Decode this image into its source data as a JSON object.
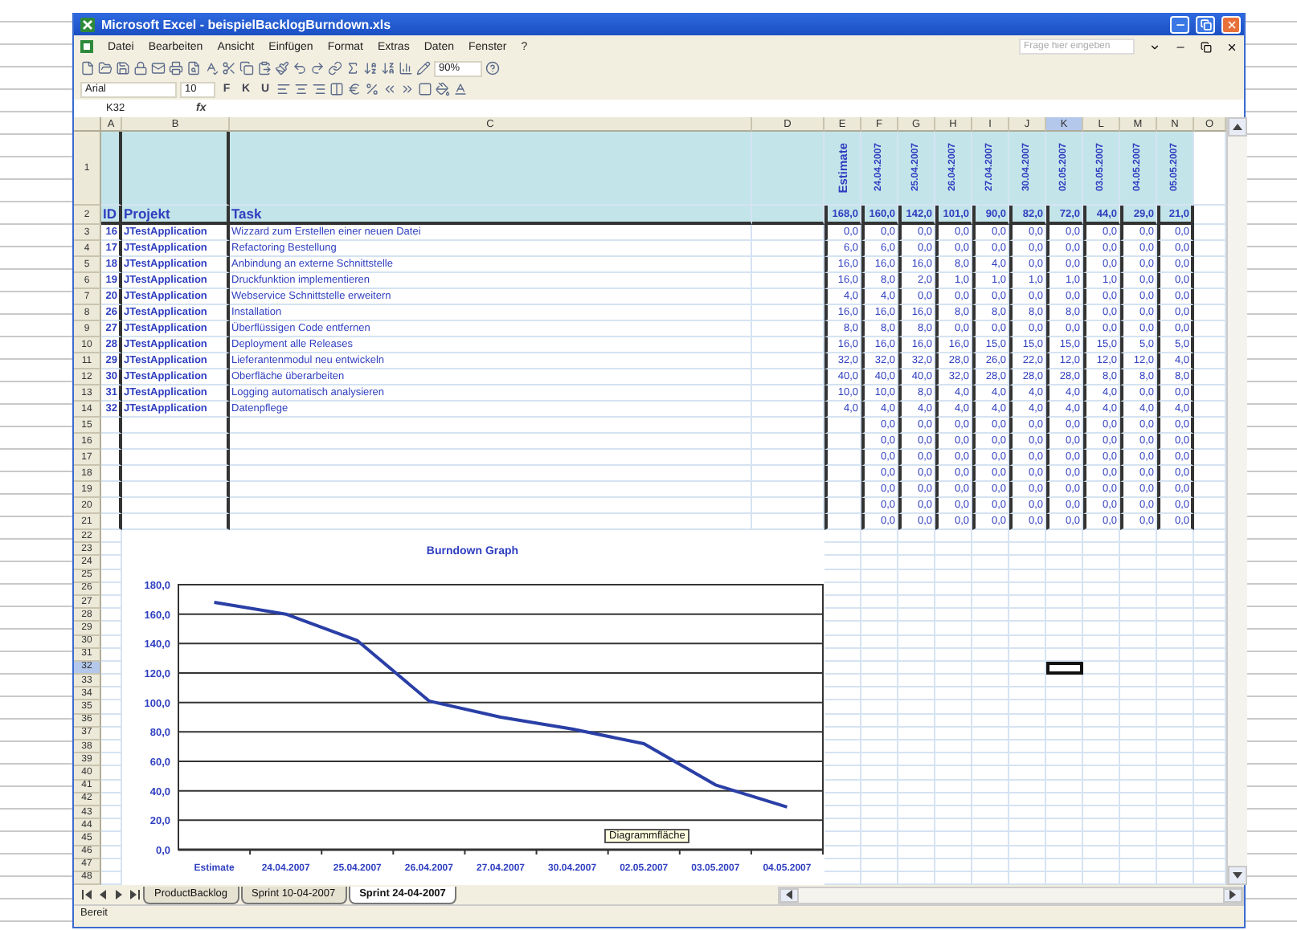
{
  "window": {
    "title": "Microsoft Excel - beispielBacklogBurndown.xls"
  },
  "menu": [
    "Datei",
    "Bearbeiten",
    "Ansicht",
    "Einfügen",
    "Format",
    "Extras",
    "Daten",
    "Fenster",
    "?"
  ],
  "help_box": {
    "placeholder": "Frage hier eingeben"
  },
  "toolbar": {
    "zoom": "90%",
    "font": "Arial",
    "font_size": "10",
    "format_buttons": [
      "F",
      "K",
      "U"
    ]
  },
  "formula_bar": {
    "name_box": "K32",
    "function_label": "fx"
  },
  "column_headers": [
    {
      "label": "A",
      "selected": false
    },
    {
      "label": "B",
      "selected": false
    },
    {
      "label": "C",
      "selected": false
    },
    {
      "label": "D",
      "selected": false
    },
    {
      "label": "E",
      "selected": false
    },
    {
      "label": "F",
      "selected": false
    },
    {
      "label": "G",
      "selected": false
    },
    {
      "label": "H",
      "selected": false
    },
    {
      "label": "I",
      "selected": false
    },
    {
      "label": "J",
      "selected": false
    },
    {
      "label": "K",
      "selected": true
    },
    {
      "label": "L",
      "selected": false
    },
    {
      "label": "M",
      "selected": false
    },
    {
      "label": "N",
      "selected": false
    },
    {
      "label": "O",
      "selected": false
    }
  ],
  "sheet": {
    "header_rows": [
      {
        "number": "1",
        "selected": false
      },
      {
        "number": "2",
        "selected": false
      }
    ],
    "headings": {
      "id": "ID",
      "project": "Projekt",
      "task": "Task"
    },
    "day_columns": [
      {
        "label": "Estimate",
        "total": "168,0"
      },
      {
        "label": "24.04.2007",
        "total": "160,0"
      },
      {
        "label": "25.04.2007",
        "total": "142,0"
      },
      {
        "label": "26.04.2007",
        "total": "101,0"
      },
      {
        "label": "27.04.2007",
        "total": "90,0"
      },
      {
        "label": "30.04.2007",
        "total": "82,0"
      },
      {
        "label": "02.05.2007",
        "total": "72,0"
      },
      {
        "label": "03.05.2007",
        "total": "44,0"
      },
      {
        "label": "04.05.2007",
        "total": "29,0"
      },
      {
        "label": "05.05.2007",
        "total": "21,0"
      }
    ],
    "rows": [
      {
        "number": "3",
        "selected": false,
        "id": "16",
        "project": "JTestApplication",
        "task": "Wizzard zum Erstellen einer neuen Datei",
        "estimate": "0,0",
        "daily": [
          "0,0",
          "0,0",
          "0,0",
          "0,0",
          "0,0",
          "0,0",
          "0,0",
          "0,0",
          "0,0"
        ]
      },
      {
        "number": "4",
        "selected": false,
        "id": "17",
        "project": "JTestApplication",
        "task": "Refactoring Bestellung",
        "estimate": "6,0",
        "daily": [
          "6,0",
          "0,0",
          "0,0",
          "0,0",
          "0,0",
          "0,0",
          "0,0",
          "0,0",
          "0,0"
        ]
      },
      {
        "number": "5",
        "selected": false,
        "id": "18",
        "project": "JTestApplication",
        "task": "Anbindung an externe Schnittstelle",
        "estimate": "16,0",
        "daily": [
          "16,0",
          "16,0",
          "8,0",
          "4,0",
          "0,0",
          "0,0",
          "0,0",
          "0,0",
          "0,0"
        ]
      },
      {
        "number": "6",
        "selected": false,
        "id": "19",
        "project": "JTestApplication",
        "task": "Druckfunktion implementieren",
        "estimate": "16,0",
        "daily": [
          "8,0",
          "2,0",
          "1,0",
          "1,0",
          "1,0",
          "1,0",
          "1,0",
          "0,0",
          "0,0"
        ]
      },
      {
        "number": "7",
        "selected": false,
        "id": "20",
        "project": "JTestApplication",
        "task": "Webservice Schnittstelle erweitern",
        "estimate": "4,0",
        "daily": [
          "4,0",
          "0,0",
          "0,0",
          "0,0",
          "0,0",
          "0,0",
          "0,0",
          "0,0",
          "0,0"
        ]
      },
      {
        "number": "8",
        "selected": false,
        "id": "26",
        "project": "JTestApplication",
        "task": "Installation",
        "estimate": "16,0",
        "daily": [
          "16,0",
          "16,0",
          "8,0",
          "8,0",
          "8,0",
          "8,0",
          "0,0",
          "0,0",
          "0,0"
        ]
      },
      {
        "number": "9",
        "selected": false,
        "id": "27",
        "project": "JTestApplication",
        "task": "Überflüssigen Code entfernen",
        "estimate": "8,0",
        "daily": [
          "8,0",
          "8,0",
          "0,0",
          "0,0",
          "0,0",
          "0,0",
          "0,0",
          "0,0",
          "0,0"
        ]
      },
      {
        "number": "10",
        "selected": false,
        "id": "28",
        "project": "JTestApplication",
        "task": "Deployment alle Releases",
        "estimate": "16,0",
        "daily": [
          "16,0",
          "16,0",
          "16,0",
          "15,0",
          "15,0",
          "15,0",
          "15,0",
          "5,0",
          "5,0"
        ]
      },
      {
        "number": "11",
        "selected": false,
        "id": "29",
        "project": "JTestApplication",
        "task": "Lieferantenmodul neu entwickeln",
        "estimate": "32,0",
        "daily": [
          "32,0",
          "32,0",
          "28,0",
          "26,0",
          "22,0",
          "12,0",
          "12,0",
          "12,0",
          "4,0"
        ]
      },
      {
        "number": "12",
        "selected": false,
        "id": "30",
        "project": "JTestApplication",
        "task": "Oberfläche überarbeiten",
        "estimate": "40,0",
        "daily": [
          "40,0",
          "40,0",
          "32,0",
          "28,0",
          "28,0",
          "28,0",
          "8,0",
          "8,0",
          "8,0"
        ]
      },
      {
        "number": "13",
        "selected": false,
        "id": "31",
        "project": "JTestApplication",
        "task": "Logging automatisch analysieren",
        "estimate": "10,0",
        "daily": [
          "10,0",
          "8,0",
          "4,0",
          "4,0",
          "4,0",
          "4,0",
          "4,0",
          "0,0",
          "0,0"
        ]
      },
      {
        "number": "14",
        "selected": false,
        "id": "32",
        "project": "JTestApplication",
        "task": "Datenpflege",
        "estimate": "4,0",
        "daily": [
          "4,0",
          "4,0",
          "4,0",
          "4,0",
          "4,0",
          "4,0",
          "4,0",
          "4,0",
          "4,0"
        ]
      },
      {
        "number": "15",
        "selected": false,
        "daily": [
          "0,0",
          "0,0",
          "0,0",
          "0,0",
          "0,0",
          "0,0",
          "0,0",
          "0,0",
          "0,0"
        ]
      },
      {
        "number": "16",
        "selected": false,
        "daily": [
          "0,0",
          "0,0",
          "0,0",
          "0,0",
          "0,0",
          "0,0",
          "0,0",
          "0,0",
          "0,0"
        ]
      },
      {
        "number": "17",
        "selected": false,
        "daily": [
          "0,0",
          "0,0",
          "0,0",
          "0,0",
          "0,0",
          "0,0",
          "0,0",
          "0,0",
          "0,0"
        ]
      },
      {
        "number": "18",
        "selected": false,
        "daily": [
          "0,0",
          "0,0",
          "0,0",
          "0,0",
          "0,0",
          "0,0",
          "0,0",
          "0,0",
          "0,0"
        ]
      },
      {
        "number": "19",
        "selected": false,
        "daily": [
          "0,0",
          "0,0",
          "0,0",
          "0,0",
          "0,0",
          "0,0",
          "0,0",
          "0,0",
          "0,0"
        ]
      },
      {
        "number": "20",
        "selected": false,
        "daily": [
          "0,0",
          "0,0",
          "0,0",
          "0,0",
          "0,0",
          "0,0",
          "0,0",
          "0,0",
          "0,0"
        ]
      },
      {
        "number": "21",
        "selected": false,
        "daily": [
          "0,0",
          "0,0",
          "0,0",
          "0,0",
          "0,0",
          "0,0",
          "0,0",
          "0,0",
          "0,0"
        ]
      },
      {
        "number": "22",
        "selected": false
      },
      {
        "number": "23",
        "selected": false
      },
      {
        "number": "24",
        "selected": false
      },
      {
        "number": "25",
        "selected": false
      },
      {
        "number": "26",
        "selected": false
      },
      {
        "number": "27",
        "selected": false
      },
      {
        "number": "28",
        "selected": false
      },
      {
        "number": "29",
        "selected": false
      },
      {
        "number": "30",
        "selected": false
      },
      {
        "number": "31",
        "selected": false
      },
      {
        "number": "32",
        "selected": true
      },
      {
        "number": "33",
        "selected": false
      },
      {
        "number": "34",
        "selected": false
      },
      {
        "number": "35",
        "selected": false
      },
      {
        "number": "36",
        "selected": false
      },
      {
        "number": "37",
        "selected": false
      },
      {
        "number": "38",
        "selected": false
      },
      {
        "number": "39",
        "selected": false
      },
      {
        "number": "40",
        "selected": false
      },
      {
        "number": "41",
        "selected": false
      },
      {
        "number": "42",
        "selected": false
      },
      {
        "number": "43",
        "selected": false
      },
      {
        "number": "44",
        "selected": false
      },
      {
        "number": "45",
        "selected": false
      },
      {
        "number": "46",
        "selected": false
      },
      {
        "number": "47",
        "selected": false
      },
      {
        "number": "48",
        "selected": false
      }
    ]
  },
  "chart": {
    "tooltip": "Diagrammfläche",
    "chart_data": {
      "type": "line",
      "title": "Burndown Graph",
      "categories": [
        "Estimate",
        "24.04.2007",
        "25.04.2007",
        "26.04.2007",
        "27.04.2007",
        "30.04.2007",
        "02.05.2007",
        "03.05.2007",
        "04.05.2007"
      ],
      "series": [
        {
          "color": "#2a3fa6",
          "values": [
            168,
            160,
            142,
            101,
            90,
            82,
            72,
            44,
            29
          ]
        }
      ],
      "grid": true,
      "ylim": [
        0,
        180
      ],
      "yticks": [
        {
          "value": 0,
          "label": "0,0"
        },
        {
          "value": 20,
          "label": "20,0"
        },
        {
          "value": 40,
          "label": "40,0"
        },
        {
          "value": 60,
          "label": "60,0"
        },
        {
          "value": 80,
          "label": "80,0"
        },
        {
          "value": 100,
          "label": "100,0"
        },
        {
          "value": 120,
          "label": "120,0"
        },
        {
          "value": 140,
          "label": "140,0"
        },
        {
          "value": 160,
          "label": "160,0"
        },
        {
          "value": 180,
          "label": "180,0"
        }
      ]
    }
  },
  "sheet_tabs": [
    {
      "label": "ProductBacklog",
      "selected": false
    },
    {
      "label": "Sprint 10-04-2007",
      "selected": false
    },
    {
      "label": "Sprint 24-04-2007",
      "selected": true
    }
  ],
  "status_bar": {
    "text": "Bereit"
  }
}
